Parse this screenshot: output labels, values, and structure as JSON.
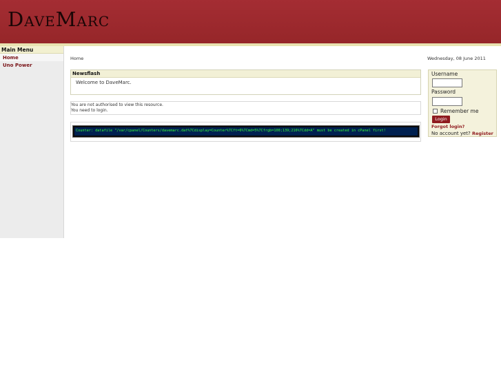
{
  "site": {
    "logo": "DaveMarc"
  },
  "sidebar": {
    "title": "Main Menu",
    "items": [
      {
        "label": "Home"
      },
      {
        "label": "Uno Power"
      }
    ]
  },
  "breadcrumb": "Home",
  "date": "Wednesday, 08 June 2011",
  "newsflash": {
    "title": "Newsflash",
    "text": "Welcome to DaveMarc."
  },
  "notice": {
    "line1": "You are not authorised to view this resource.",
    "line2": "You need to login."
  },
  "counter": {
    "text": "Counter: datafile \"/var/cpanel/Counters/davemarc.dat%7Cdisplay=Counter%7Cft=6%7Cmd=5%7Cfrgb=100;139;216%7Cdd=A\" must be created in cPanel first!"
  },
  "login": {
    "username_label": "Username",
    "password_label": "Password",
    "remember_label": "Remember me",
    "button_label": "Login",
    "forgot_label": "Forgot login?",
    "no_account_label": "No account yet?",
    "register_label": "Register"
  }
}
